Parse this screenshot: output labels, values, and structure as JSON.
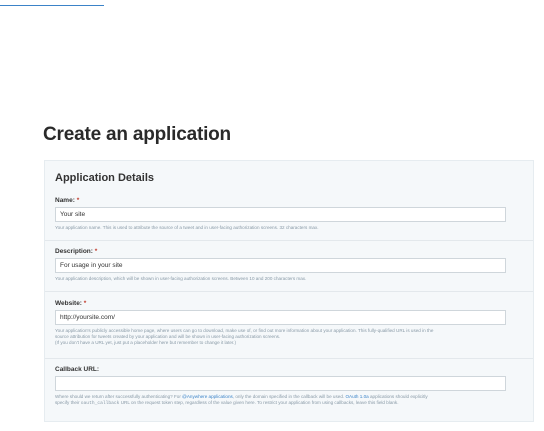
{
  "page": {
    "title": "Create an application"
  },
  "panel": {
    "title": "Application Details"
  },
  "fields": {
    "name": {
      "label": "Name:",
      "required_mark": "*",
      "value": "Your site",
      "help": "Your application name. This is used to attribute the source of a tweet and in user-facing authorization screens. 32 characters max."
    },
    "description": {
      "label": "Description:",
      "required_mark": "*",
      "value": "For usage in your site",
      "help": "Your application description, which will be shown in user-facing authorization screens. Between 10 and 200 characters max."
    },
    "website": {
      "label": "Website:",
      "required_mark": "*",
      "value": "http://yoursite.com/",
      "help": [
        "Your application's publicly accessible home page, where users can go to download, make use of, or find out more information about your application. This fully-qualified URL is used in the",
        "source attribution for tweets created by your application and will be shown in user-facing authorization screens.",
        "(If you don't have a URL yet, just put a placeholder here but remember to change it later.)"
      ]
    },
    "callback": {
      "label": "Callback URL:",
      "value": "",
      "help": {
        "p1": "Where should we return after successfully authenticating? For",
        "link1": "@Anywhere applications",
        "p2": ", only the domain specified in the callback will be used.",
        "link2": "OAuth 1.0a",
        "p3": "applications should explicitly",
        "p4": "specify their",
        "code": "oauth_callback",
        "p5": "URL on the request token step, regardless of the value given here. To restrict your application from using callbacks, leave this field blank."
      }
    }
  },
  "colors": {
    "link": "#3b83c8",
    "required": "#c0392b"
  }
}
